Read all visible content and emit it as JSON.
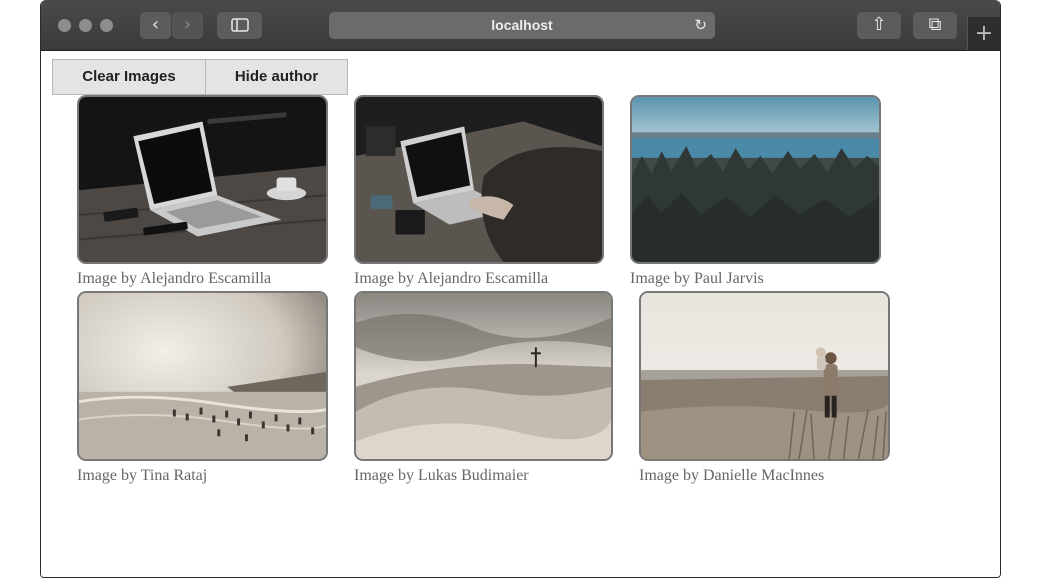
{
  "browser": {
    "address": "localhost",
    "back_glyph": "‹",
    "forward_glyph": "›",
    "reload_glyph": "↻",
    "share_glyph": "⇧",
    "tabs_glyph": "⧉",
    "newtab_glyph": "+"
  },
  "toolbar": {
    "clear_label": "Clear Images",
    "hide_label": "Hide author"
  },
  "images": [
    {
      "caption": "Image by Alejandro Escamilla",
      "subject": "laptop-on-table"
    },
    {
      "caption": "Image by Alejandro Escamilla",
      "subject": "person-typing-on-laptop"
    },
    {
      "caption": "Image by Paul Jarvis",
      "subject": "forest-and-lake"
    },
    {
      "caption": "Image by Tina Rataj",
      "subject": "crowded-beach"
    },
    {
      "caption": "Image by Lukas Budimaier",
      "subject": "sand-dunes"
    },
    {
      "caption": "Image by Danielle MacInnes",
      "subject": "man-carrying-child-in-field"
    }
  ]
}
